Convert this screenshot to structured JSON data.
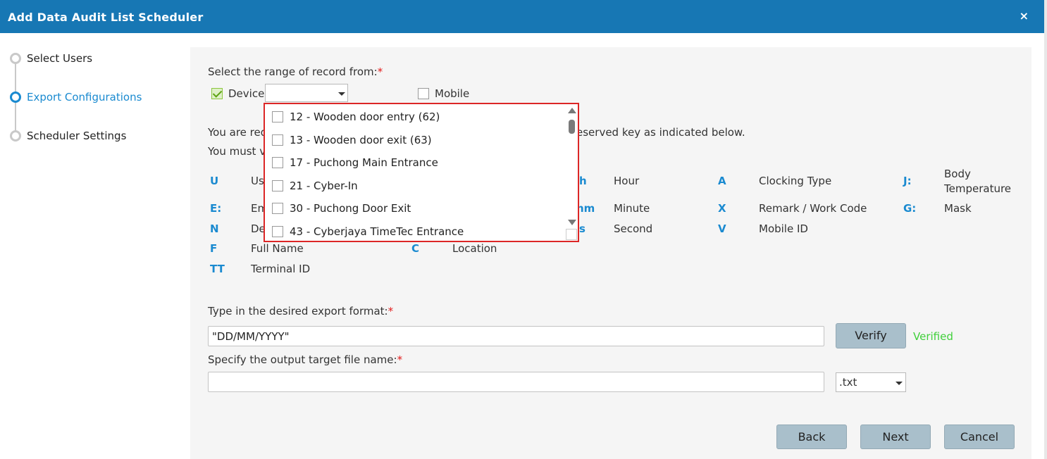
{
  "dialog": {
    "title": "Add Data Audit List Scheduler",
    "close_glyph": "×"
  },
  "steps": [
    {
      "label": "Select Users",
      "active": false
    },
    {
      "label": "Export Configurations",
      "active": true
    },
    {
      "label": "Scheduler Settings",
      "active": false
    }
  ],
  "range": {
    "label": "Select the range of record from:",
    "required_mark": "*",
    "device_label": "Device",
    "device_checked": true,
    "mobile_label": "Mobile",
    "mobile_checked": false
  },
  "info": {
    "line1_start": "You are req",
    "line1_end": "eserved key as indicated below.",
    "line2_start": "You must v"
  },
  "keys": [
    {
      "key": "U",
      "desc": "Us"
    },
    {
      "key": "h",
      "desc": "Hour"
    },
    {
      "key": "A",
      "desc": "Clocking Type"
    },
    {
      "key": "J:",
      "desc_line1": "Body",
      "desc_line2": "Temperature"
    },
    {
      "key": "E:",
      "desc": "Em"
    },
    {
      "key": "hm",
      "desc": "Minute"
    },
    {
      "key": "X",
      "desc": "Remark / Work Code"
    },
    {
      "key": "G:",
      "desc": "Mask"
    },
    {
      "key": "N",
      "desc": "De"
    },
    {
      "key": "s",
      "desc": "Second"
    },
    {
      "key": "V",
      "desc": "Mobile ID"
    },
    {
      "key": "F",
      "desc": "Full Name"
    },
    {
      "key": "C",
      "desc": "Location"
    },
    {
      "key": "TT",
      "desc": "Terminal ID"
    }
  ],
  "device_dropdown": {
    "selected": "",
    "options": [
      {
        "label": "12 - Wooden door entry (62)",
        "checked": false
      },
      {
        "label": "13 - Wooden door exit (63)",
        "checked": false
      },
      {
        "label": "17 - Puchong Main Entrance",
        "checked": false
      },
      {
        "label": "21 - Cyber-In",
        "checked": false
      },
      {
        "label": "30 - Puchong Door Exit",
        "checked": false
      },
      {
        "label": "43 - Cyberjaya TimeTec Entrance",
        "checked": false
      }
    ]
  },
  "export_format": {
    "label": "Type in the desired export format:",
    "required_mark": "*",
    "value": "\"DD/MM/YYYY\"",
    "verify_label": "Verify",
    "status": "Verified"
  },
  "output_file": {
    "label": "Specify the output target file name:",
    "required_mark": "*",
    "value": "",
    "extension": ".txt"
  },
  "footer": {
    "back": "Back",
    "next": "Next",
    "cancel": "Cancel"
  },
  "colors": {
    "header": "#1777b4",
    "accent": "#1a8ad0",
    "verified": "#3fd03a",
    "highlight_border": "#dc2626"
  }
}
